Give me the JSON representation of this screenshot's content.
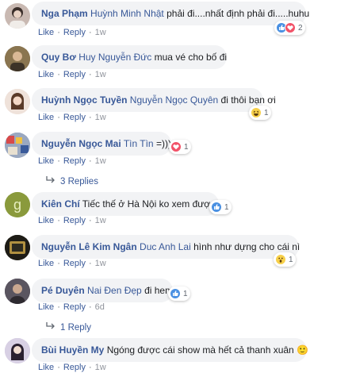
{
  "actions": {
    "like": "Like",
    "reply": "Reply",
    "sep": "·"
  },
  "comments": [
    {
      "author": "Nga Phạm",
      "mention": "Huỳnh Minh Nhật",
      "text": "phải đi....nhất định phải đi.....huhu",
      "time": "1w",
      "reactions": [
        "like",
        "love"
      ],
      "reaction_count": "2",
      "avatar_color": "#c9b9b2"
    },
    {
      "author": "Quy Bơ",
      "mention": "Huy Nguyễn Đức",
      "text": "mua vé cho bố đi",
      "time": "1w",
      "reactions": [],
      "reaction_count": "",
      "avatar_color": "#6b5a3a"
    },
    {
      "author": "Huỳnh Ngọc Tuyền",
      "mention": "Nguyễn Ngọc Quyên",
      "text": "đi thôi bạn ơi",
      "time": "1w",
      "reactions": [
        "haha"
      ],
      "reaction_count": "1",
      "avatar_color": "#e8d4cc"
    },
    {
      "author": "Nguyễn Ngọc Mai",
      "mention": "Tìn Tìn",
      "text": "=)))",
      "time": "1w",
      "reactions": [
        "love"
      ],
      "reaction_count": "1",
      "avatar_color": "#7b8fb0",
      "replies": "3 Replies"
    },
    {
      "author": "Kiên Chí",
      "mention": "",
      "text": "Tiếc thế ở Hà Nội ko xem được",
      "time": "1w",
      "reactions": [
        "like"
      ],
      "reaction_count": "1",
      "avatar_color": "#8a9a3c",
      "avatar_letter": "g"
    },
    {
      "author": "Nguyễn Lê Kim Ngân",
      "mention": "Duc Anh Lai",
      "text": "hình như dựng cho cái nì",
      "time": "1w",
      "reactions": [
        "wow"
      ],
      "reaction_count": "1",
      "avatar_color": "#2c2a20"
    },
    {
      "author": "Pé Duyên",
      "mention": "Nai Đen Đẹp",
      "text": "đi hem",
      "time": "6d",
      "reactions": [
        "like"
      ],
      "reaction_count": "1",
      "avatar_color": "#4a4550",
      "replies": "1 Reply"
    },
    {
      "author": "Bùi Huyền My",
      "mention": "",
      "text": "Ngóng được cái show mà hết cả thanh xuân",
      "time": "1w",
      "reactions": [],
      "reaction_count": "",
      "avatar_color": "#c8c0d8",
      "emoji": "🙂"
    }
  ],
  "colors": {
    "link": "#385898",
    "bubble": "#f2f3f5",
    "like": "#4a90e2",
    "love": "#f25268",
    "haha": "#f7d04a"
  }
}
